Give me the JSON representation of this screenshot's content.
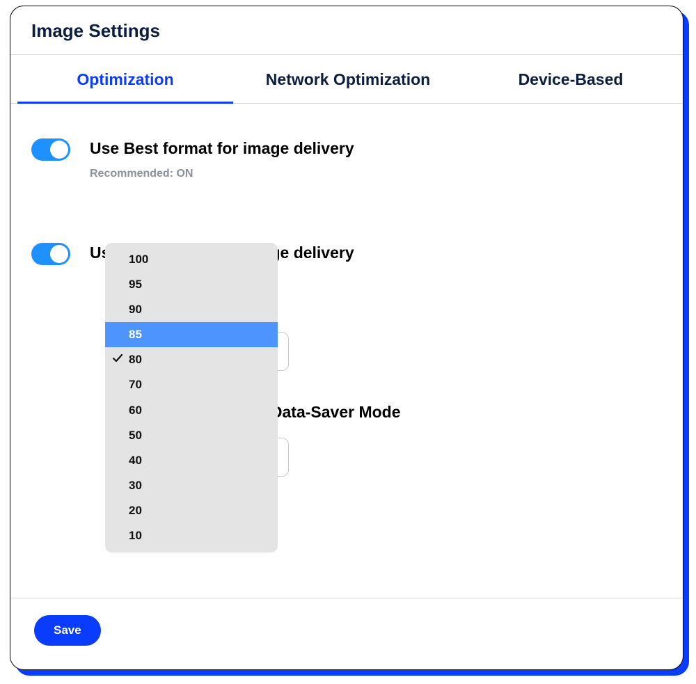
{
  "header": {
    "title": "Image Settings"
  },
  "tabs": [
    {
      "label": "Optimization",
      "active": true
    },
    {
      "label": "Network Optimization",
      "active": false
    },
    {
      "label": "Device-Based",
      "active": false
    }
  ],
  "settings": {
    "best_format_1": {
      "title": "Use Best format for image delivery",
      "sub": "Recommended: ON",
      "toggle_on": true
    },
    "best_format_2": {
      "title": "Use Best format for image delivery",
      "toggle_on": true
    },
    "data_saver_title_fragment": "r of Data-Saver Mode"
  },
  "dropdown": {
    "options": [
      "100",
      "95",
      "90",
      "85",
      "80",
      "70",
      "60",
      "50",
      "40",
      "30",
      "20",
      "10"
    ],
    "hovered": "85",
    "checked": "80"
  },
  "footer": {
    "save_label": "Save"
  }
}
